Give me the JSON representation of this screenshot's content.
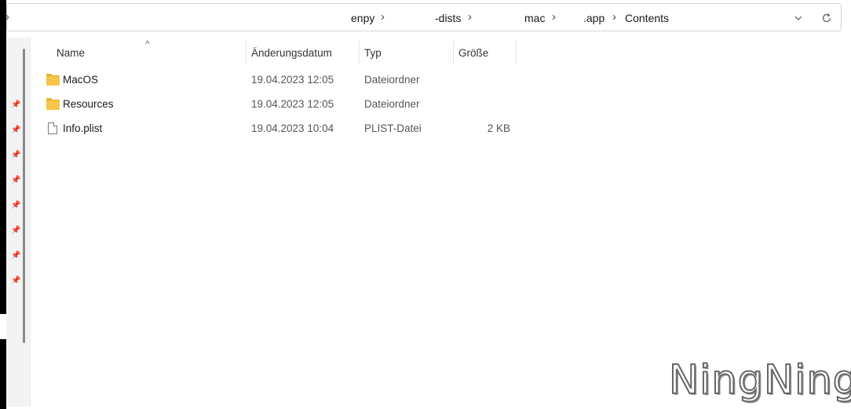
{
  "addressbar": {
    "crumbs": [
      "enpy",
      "-dists",
      "mac",
      ".app",
      "Contents"
    ],
    "left_chevron": "›",
    "separator": "›",
    "dropdown_icon": "chevron-down-icon",
    "refresh_icon": "refresh-icon"
  },
  "columns": {
    "name": "Name",
    "date": "Änderungsdatum",
    "type": "Typ",
    "size": "Größe"
  },
  "files": [
    {
      "name": "MacOS",
      "date": "19.04.2023 12:05",
      "type": "Dateiordner",
      "size": "",
      "icon": "folder-icon"
    },
    {
      "name": "Resources",
      "date": "19.04.2023 12:05",
      "type": "Dateiordner",
      "size": "",
      "icon": "folder-icon"
    },
    {
      "name": "Info.plist",
      "date": "19.04.2023 10:04",
      "type": "PLIST-Datei",
      "size": "2 KB",
      "icon": "file-icon"
    }
  ],
  "watermark": "NingNing"
}
